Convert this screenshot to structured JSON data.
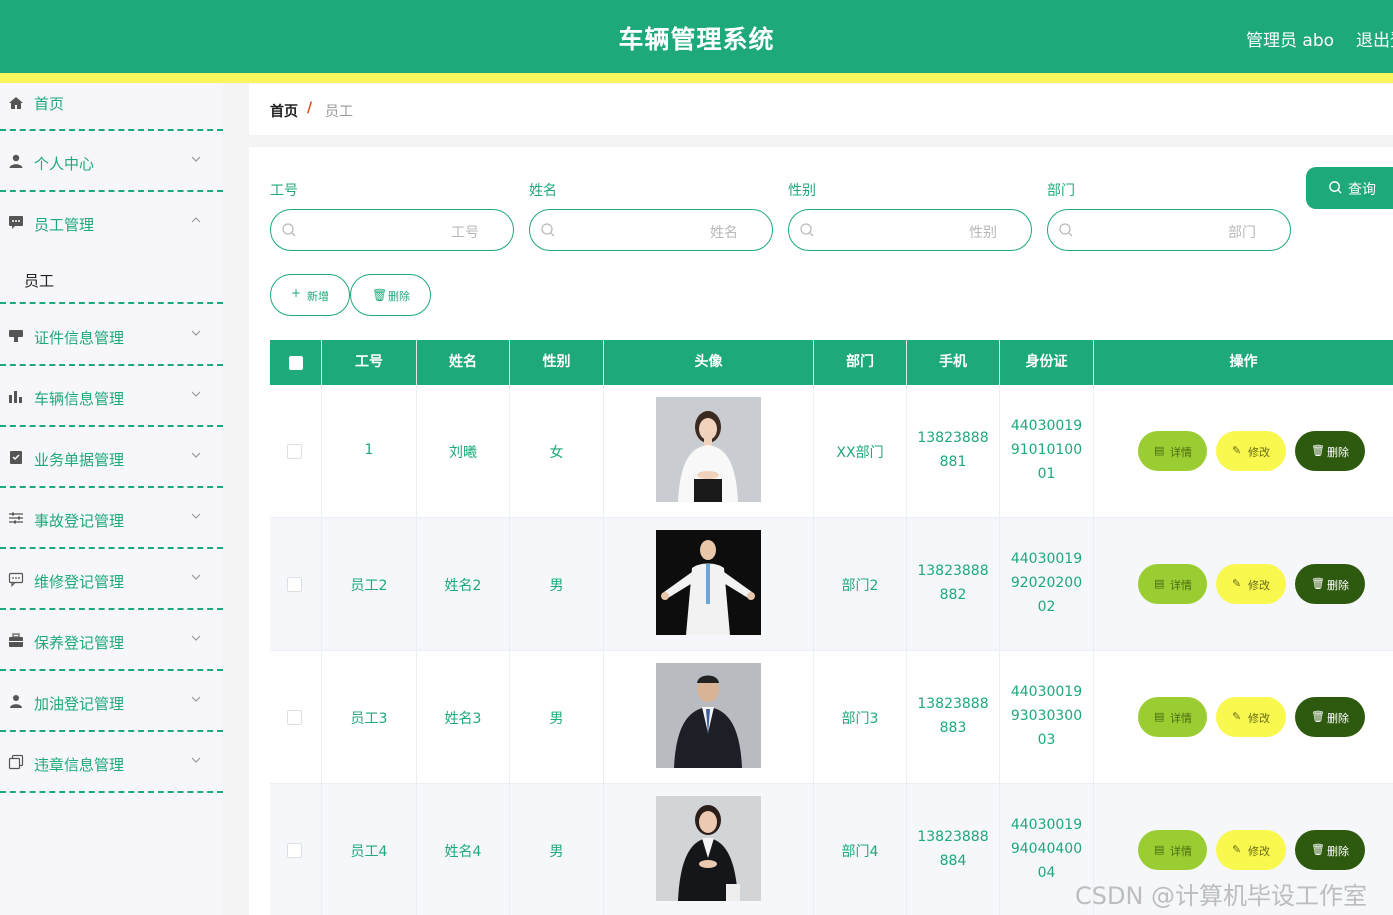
{
  "header": {
    "title": "车辆管理系统",
    "admin_label": "管理员 abo",
    "logout_label": "退出登录"
  },
  "sidebar": {
    "home": {
      "label": "首页",
      "icon": "home-icon"
    },
    "items": [
      {
        "label": "个人中心",
        "icon": "user-icon"
      },
      {
        "label": "员工管理",
        "icon": "chat-icon",
        "expanded": true,
        "children": [
          "员工"
        ]
      },
      {
        "label": "证件信息管理",
        "icon": "card-icon"
      },
      {
        "label": "车辆信息管理",
        "icon": "bar-chart-icon"
      },
      {
        "label": "业务单据管理",
        "icon": "clipboard-icon"
      },
      {
        "label": "事故登记管理",
        "icon": "sliders-icon"
      },
      {
        "label": "维修登记管理",
        "icon": "message-icon"
      },
      {
        "label": "保养登记管理",
        "icon": "briefcase-icon"
      },
      {
        "label": "加油登记管理",
        "icon": "person-icon"
      },
      {
        "label": "违章信息管理",
        "icon": "copy-icon"
      }
    ]
  },
  "breadcrumb": {
    "home": "首页",
    "separator": "/",
    "current": "员工"
  },
  "search": {
    "fields": [
      {
        "label": "工号",
        "placeholder": "工号"
      },
      {
        "label": "姓名",
        "placeholder": "姓名"
      },
      {
        "label": "性别",
        "placeholder": "性别"
      },
      {
        "label": "部门",
        "placeholder": "部门"
      }
    ],
    "query_label": "查询"
  },
  "actions": {
    "add_label": "新增",
    "delete_label": "删除"
  },
  "table": {
    "columns": [
      "工号",
      "姓名",
      "性别",
      "头像",
      "部门",
      "手机",
      "身份证",
      "操作"
    ],
    "rows": [
      {
        "id": "1",
        "name": "刘曦",
        "gender": "女",
        "dept": "XX部门",
        "phone1": "13823888",
        "phone2": "881",
        "idc1": "44030019",
        "idc2": "91010100",
        "idc3": "01"
      },
      {
        "id": "员工2",
        "name": "姓名2",
        "gender": "男",
        "dept": "部门2",
        "phone1": "13823888",
        "phone2": "882",
        "idc1": "44030019",
        "idc2": "92020200",
        "idc3": "02"
      },
      {
        "id": "员工3",
        "name": "姓名3",
        "gender": "男",
        "dept": "部门3",
        "phone1": "13823888",
        "phone2": "883",
        "idc1": "44030019",
        "idc2": "93030300",
        "idc3": "03"
      },
      {
        "id": "员工4",
        "name": "姓名4",
        "gender": "男",
        "dept": "部门4",
        "phone1": "13823888",
        "phone2": "884",
        "idc1": "44030019",
        "idc2": "94040400",
        "idc3": "04"
      }
    ],
    "row_actions": {
      "detail": "详情",
      "edit": "修改",
      "delete": "删除"
    }
  },
  "watermark": "CSDN @计算机毕设工作室",
  "colors": {
    "primary": "#1ea97a",
    "accent_yellow": "#f7f75d",
    "detail_btn": "#9acd32",
    "edit_btn": "#f8f84e",
    "delete_btn": "#2e5a0f"
  }
}
